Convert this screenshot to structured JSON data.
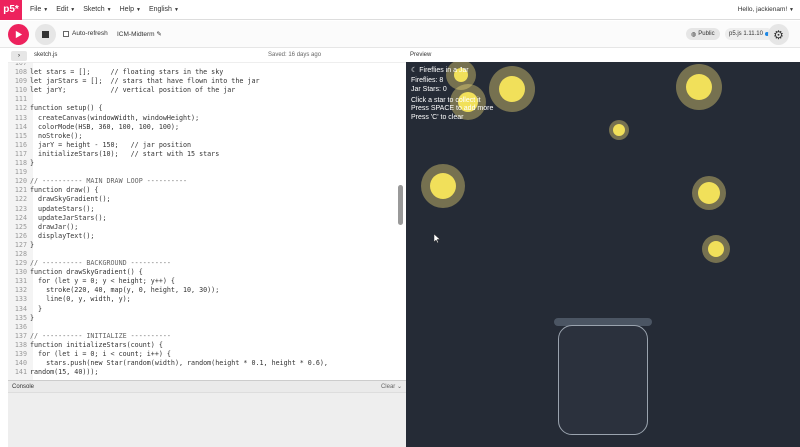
{
  "menu": {
    "logo": "p5*",
    "items": [
      "File",
      "Edit",
      "Sketch",
      "Help",
      "English"
    ],
    "user": "Hello, jackienam!"
  },
  "toolbar": {
    "autorefresh_label": "Auto-refresh",
    "sketch_name": "ICM-Midterm",
    "visibility": "Public",
    "version": "p5.js 1.11.10"
  },
  "editor": {
    "filename": "sketch.js",
    "saved": "Saved: 16 days ago",
    "preview_label": "Preview",
    "lines": [
      {
        "n": "107",
        "t": ""
      },
      {
        "n": "108",
        "t": "let stars = [];     // floating stars in the sky"
      },
      {
        "n": "109",
        "t": "let jarStars = [];  // stars that have flown into the jar"
      },
      {
        "n": "110",
        "t": "let jarY;           // vertical position of the jar"
      },
      {
        "n": "111",
        "t": ""
      },
      {
        "n": "112",
        "t": "function setup() {"
      },
      {
        "n": "113",
        "t": "  createCanvas(windowWidth, windowHeight);"
      },
      {
        "n": "114",
        "t": "  colorMode(HSB, 360, 100, 100, 100);"
      },
      {
        "n": "115",
        "t": "  noStroke();"
      },
      {
        "n": "116",
        "t": "  jarY = height - 150;   // jar position"
      },
      {
        "n": "117",
        "t": "  initializeStars(10);   // start with 15 stars"
      },
      {
        "n": "118",
        "t": "}"
      },
      {
        "n": "119",
        "t": ""
      },
      {
        "n": "120",
        "t": "// ---------- MAIN DRAW LOOP ----------"
      },
      {
        "n": "121",
        "t": "function draw() {"
      },
      {
        "n": "122",
        "t": "  drawSkyGradient();"
      },
      {
        "n": "123",
        "t": "  updateStars();"
      },
      {
        "n": "124",
        "t": "  updateJarStars();"
      },
      {
        "n": "125",
        "t": "  drawJar();"
      },
      {
        "n": "126",
        "t": "  displayText();"
      },
      {
        "n": "127",
        "t": "}"
      },
      {
        "n": "128",
        "t": ""
      },
      {
        "n": "129",
        "t": "// ---------- BACKGROUND ----------"
      },
      {
        "n": "130",
        "t": "function drawSkyGradient() {"
      },
      {
        "n": "131",
        "t": "  for (let y = 0; y < height; y++) {"
      },
      {
        "n": "132",
        "t": "    stroke(220, 40, map(y, 0, height, 10, 30));"
      },
      {
        "n": "133",
        "t": "    line(0, y, width, y);"
      },
      {
        "n": "134",
        "t": "  }"
      },
      {
        "n": "135",
        "t": "}"
      },
      {
        "n": "136",
        "t": ""
      },
      {
        "n": "137",
        "t": "// ---------- INITIALIZE ----------"
      },
      {
        "n": "138",
        "t": "function initializeStars(count) {"
      },
      {
        "n": "139",
        "t": "  for (let i = 0; i < count; i++) {"
      },
      {
        "n": "140",
        "t": "    stars.push(new Star(random(width), random(height * 0.1, height * 0.6),"
      },
      {
        "n": "141",
        "t": "random(15, 40)));"
      }
    ]
  },
  "console": {
    "label": "Console",
    "clear": "Clear"
  },
  "preview": {
    "title": "Fireflies in a Jar",
    "fireflies": "Fireflies: 8",
    "jar_stars": "Jar Stars: 0",
    "hint1": "Click a star to collect it",
    "hint2": "Press SPACE to add more",
    "hint3": "Press 'C' to clear",
    "bg_color": "#252b36",
    "star_color": "#f1e05a"
  }
}
